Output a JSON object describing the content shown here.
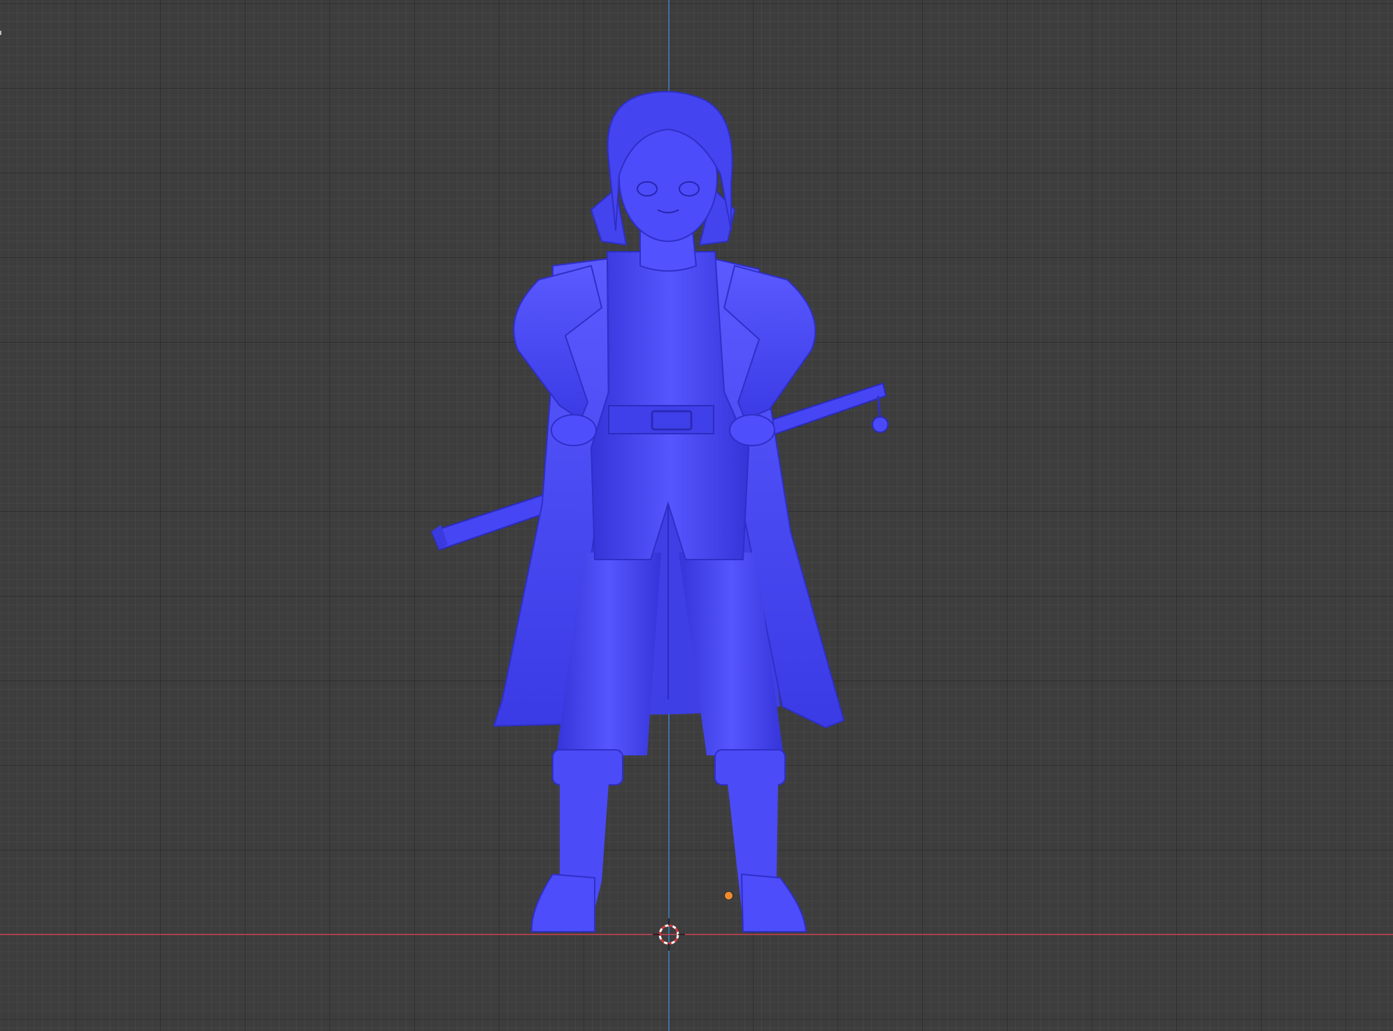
{
  "viewport": {
    "view": "front-orthographic",
    "background_color": "#3d3d3d",
    "grid": true
  },
  "axes": {
    "x_axis_color": "#b4444f",
    "z_axis_color": "#3f7ab5"
  },
  "model": {
    "shading": "solid",
    "color": "#4d4dfb",
    "selected": false
  },
  "icons": {
    "cursor": "3d-cursor-icon",
    "origin": "object-origin-icon"
  }
}
